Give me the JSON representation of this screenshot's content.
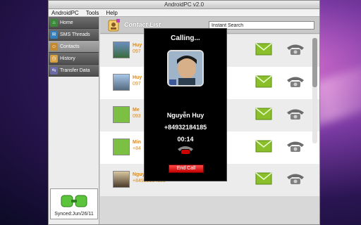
{
  "window": {
    "title": "AndroidPC v2.0"
  },
  "menu": [
    "AndroidPC",
    "Tools",
    "Help"
  ],
  "sidebar": {
    "items": [
      {
        "label": "Home",
        "icon": "home-icon",
        "active": false
      },
      {
        "label": "SMS Threads",
        "icon": "sms-icon",
        "active": false
      },
      {
        "label": "Contacts",
        "icon": "contacts-icon",
        "active": true
      },
      {
        "label": "History",
        "icon": "history-icon",
        "active": false
      },
      {
        "label": "Transfer Data",
        "icon": "transfer-icon",
        "active": false
      }
    ],
    "sync_text": "Synced:Jun/26/11"
  },
  "header": {
    "title": "Contact List",
    "search_value": "Instant Search"
  },
  "contacts": [
    {
      "name": "Huy",
      "phone": "097"
    },
    {
      "name": "Huy",
      "phone": "097"
    },
    {
      "name": "Me",
      "phone": "093"
    },
    {
      "name": "Min",
      "phone": "+84"
    },
    {
      "name": "Nguyễn Huy",
      "phone": "+84932184185"
    }
  ],
  "dialog": {
    "title": "Calling...",
    "name": "Nguyễn Huy",
    "number": "+84932184185",
    "duration": "00:14",
    "end_button": "End Call"
  },
  "colors": {
    "accent_orange": "#d78a1f",
    "end_call_red": "#d60000",
    "mail_green": "#8bbf2a"
  }
}
